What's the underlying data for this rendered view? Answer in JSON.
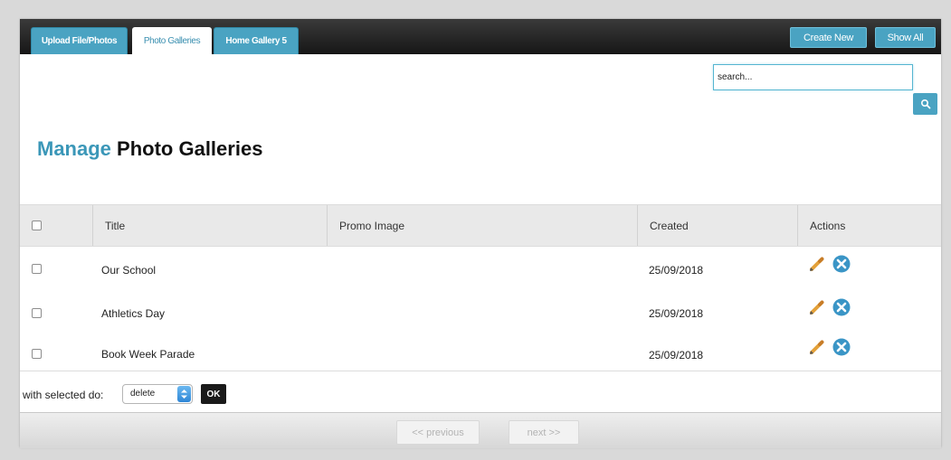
{
  "tabs": [
    {
      "label": "Upload File/Photos"
    },
    {
      "label": "Photo Galleries"
    },
    {
      "label": "Home Gallery 5"
    }
  ],
  "toolbar": {
    "create_new": "Create New",
    "show_all": "Show All"
  },
  "search": {
    "placeholder": "search..."
  },
  "page": {
    "title_accent": "Manage",
    "title_rest": "Photo Galleries"
  },
  "table": {
    "columns": [
      "Title",
      "Promo Image",
      "Created",
      "Actions"
    ],
    "rows": [
      {
        "title": "Our School",
        "promo_image": "",
        "created": "25/09/2018"
      },
      {
        "title": "Athletics Day",
        "promo_image": "",
        "created": "25/09/2018"
      },
      {
        "title": "Book Week Parade",
        "promo_image": "",
        "created": "25/09/2018"
      }
    ],
    "row_action_icons": [
      "pencil-icon",
      "delete-icon"
    ]
  },
  "bulk": {
    "label": "with selected do:",
    "selected": "delete",
    "ok": "OK"
  },
  "pagination": {
    "previous": "<< previous",
    "next": "next >>"
  },
  "colors": {
    "accent": "#4aa3c2",
    "title_accent": "#3b97b8",
    "topbar": "#1e1e1e",
    "delete": "#3a95c6",
    "pencil": "#e3a13a"
  }
}
